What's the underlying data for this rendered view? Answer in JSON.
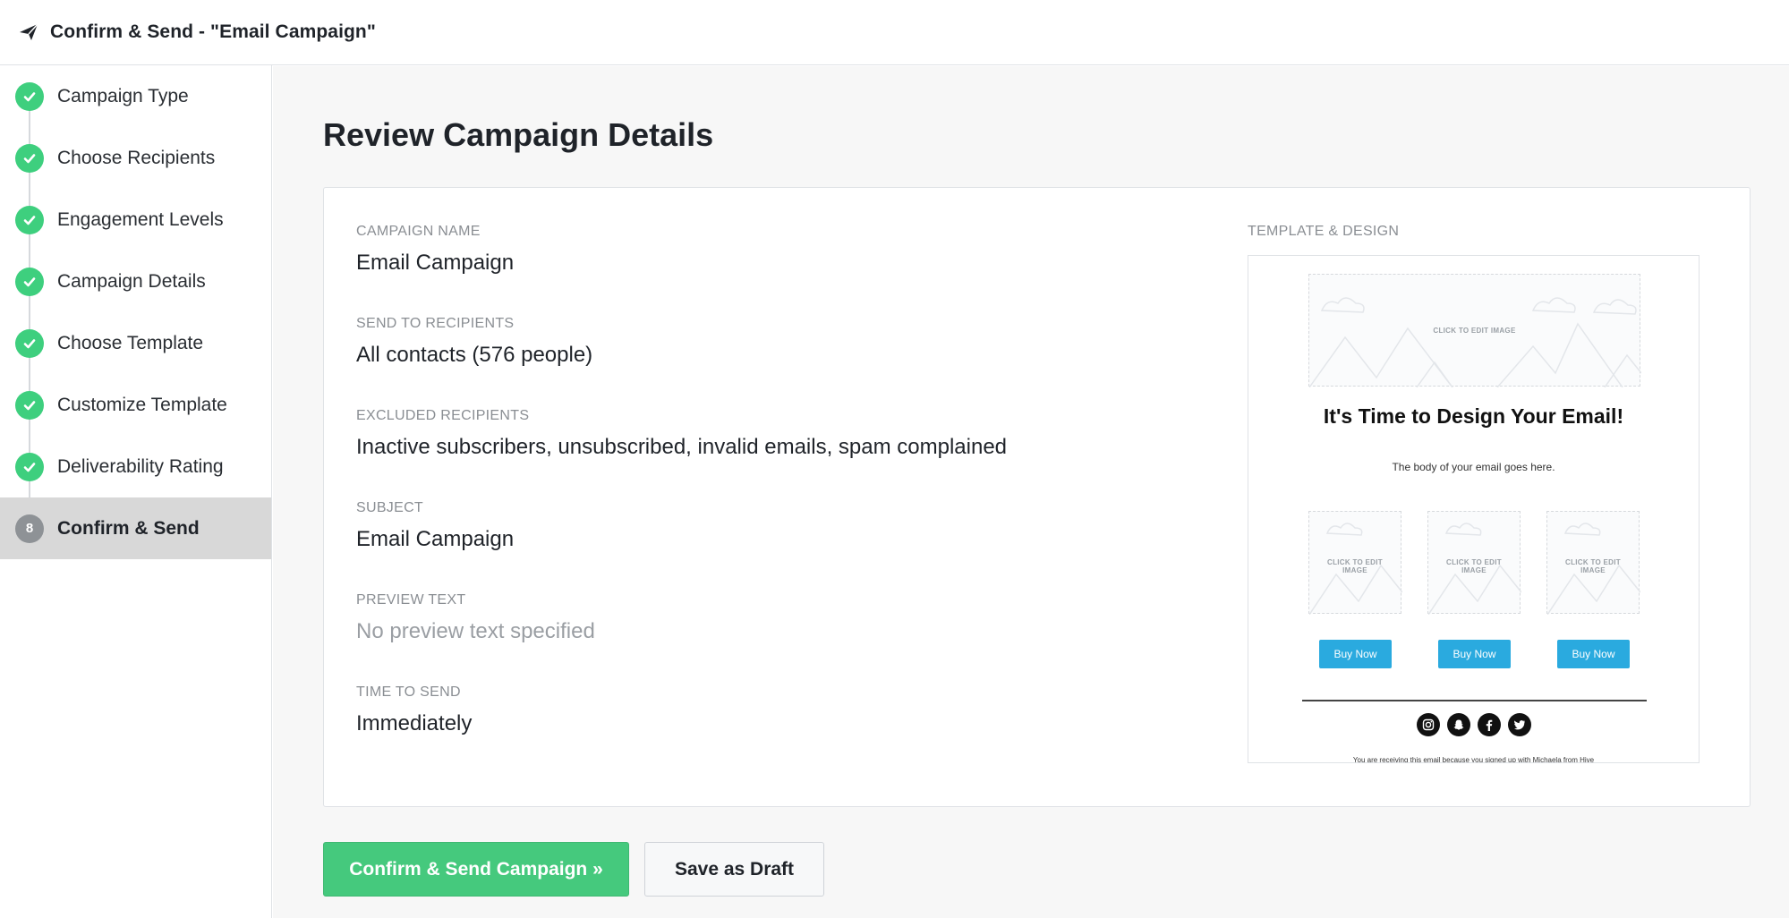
{
  "header": {
    "title": "Confirm & Send - \"Email Campaign\"",
    "icon": "paper-plane-icon"
  },
  "sidebar": {
    "steps": [
      {
        "label": "Campaign Type",
        "status": "done"
      },
      {
        "label": "Choose Recipients",
        "status": "done"
      },
      {
        "label": "Engagement Levels",
        "status": "done"
      },
      {
        "label": "Campaign Details",
        "status": "done"
      },
      {
        "label": "Choose Template",
        "status": "done"
      },
      {
        "label": "Customize Template",
        "status": "done"
      },
      {
        "label": "Deliverability Rating",
        "status": "done"
      },
      {
        "label": "Confirm & Send",
        "status": "active",
        "number": "8"
      }
    ]
  },
  "main": {
    "title": "Review Campaign Details",
    "fields": [
      {
        "label": "CAMPAIGN NAME",
        "value": "Email Campaign"
      },
      {
        "label": "SEND TO RECIPIENTS",
        "value": "All contacts (576 people)"
      },
      {
        "label": "EXCLUDED RECIPIENTS",
        "value": "Inactive subscribers, unsubscribed, invalid emails, spam complained"
      },
      {
        "label": "SUBJECT",
        "value": "Email Campaign"
      },
      {
        "label": "PREVIEW TEXT",
        "value": "No preview text specified"
      },
      {
        "label": "TIME TO SEND",
        "value": "Immediately"
      }
    ],
    "template": {
      "label": "TEMPLATE & DESIGN",
      "hero_placeholder": "CLICK TO EDIT IMAGE",
      "heading": "It's Time to Design Your Email!",
      "body": "The body of your email goes here.",
      "product_placeholder_line1": "CLICK TO EDIT",
      "product_placeholder_line2": "IMAGE",
      "buy_button": "Buy Now",
      "socials": [
        "instagram-icon",
        "snapchat-icon",
        "facebook-icon",
        "twitter-icon"
      ],
      "footer": "You are receiving this email because you signed up with Michaela from Hive"
    }
  },
  "actions": {
    "confirm": "Confirm & Send Campaign »",
    "draft": "Save as Draft"
  },
  "colors": {
    "accent_green": "#45c97d",
    "check_green": "#3ecf7e",
    "buy_blue": "#2aaadf",
    "active_step_bg": "#d8d8d8"
  }
}
